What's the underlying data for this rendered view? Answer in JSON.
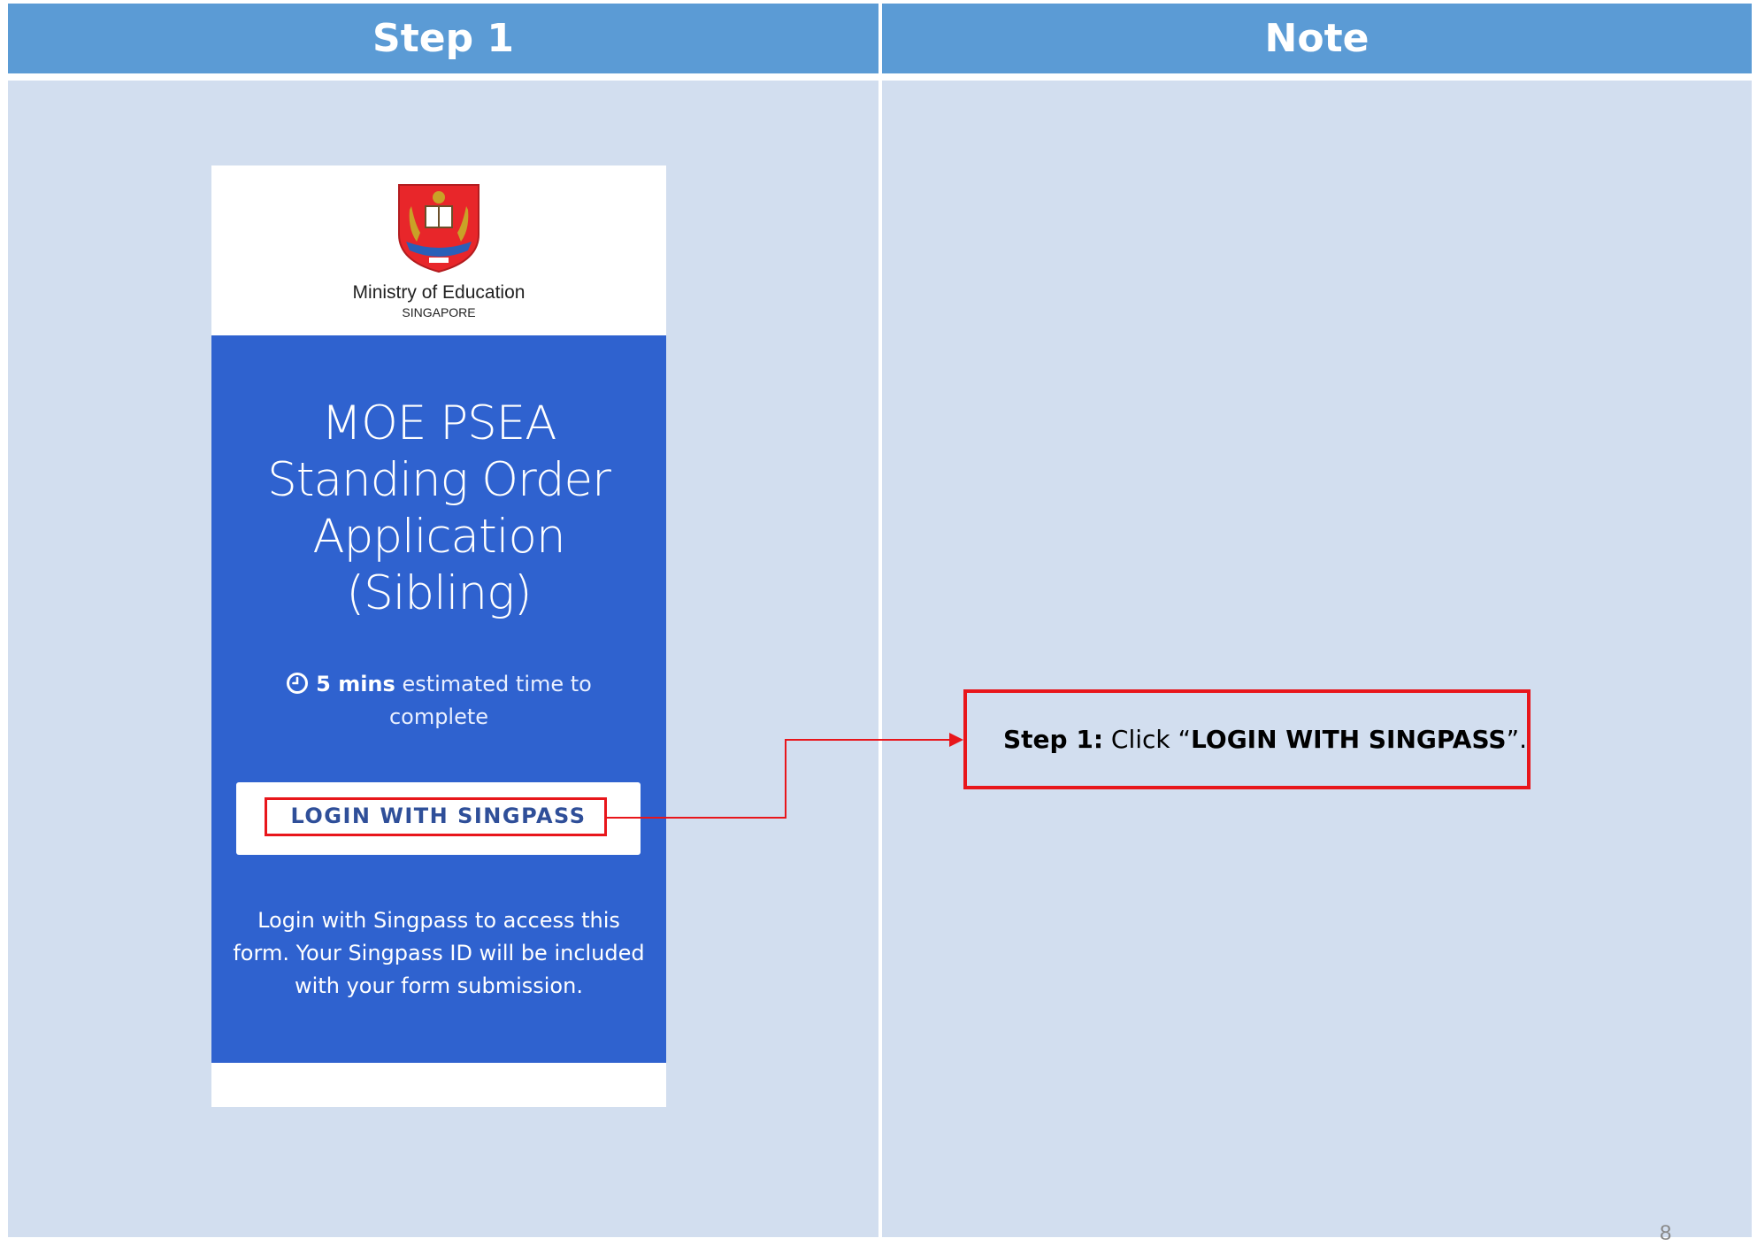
{
  "headers": {
    "left": "Step 1",
    "right": "Note"
  },
  "phone": {
    "org_name": "Ministry of Education",
    "org_sub": "SINGAPORE",
    "title_lines": [
      "MOE PSEA",
      "Standing Order",
      "Application",
      "(Sibling)"
    ],
    "time_bold": "5 mins",
    "time_rest": " estimated time to complete",
    "login_button": "LOGIN WITH SINGPASS",
    "login_description": "Login with Singpass to access this form. Your Singpass ID will be included with your form submission."
  },
  "note": {
    "step_label": "Step 1:",
    "text_before": " Click “",
    "target": "LOGIN WITH SINGPASS",
    "text_after": "”."
  },
  "page_number": "8",
  "icons": {
    "crest": "moe-crest-logo",
    "clock": "clock-icon"
  },
  "colors": {
    "header": "#5b9bd5",
    "panel": "#d2deef",
    "form_blue": "#2f62cf",
    "highlight": "#e8161b"
  }
}
